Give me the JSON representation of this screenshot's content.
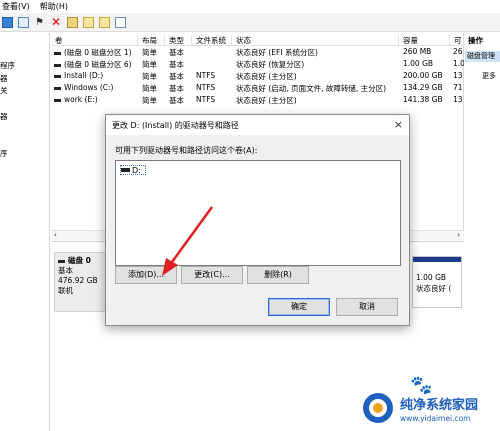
{
  "menu": {
    "items": [
      "查看(V)",
      "帮助(H)"
    ]
  },
  "left_nav": {
    "items": [
      "程序",
      "器",
      "关",
      "器",
      "",
      "序"
    ]
  },
  "table": {
    "headers": [
      "卷",
      "布局",
      "类型",
      "文件系统",
      "状态",
      "容量",
      "可"
    ],
    "rows": [
      [
        "(磁盘 0 磁盘分区 1)",
        "简单",
        "基本",
        "",
        "状态良好 (EFI 系统分区)",
        "260 MB",
        "26"
      ],
      [
        "(磁盘 0 磁盘分区 6)",
        "简单",
        "基本",
        "",
        "状态良好 (恢复分区)",
        "1.00 GB",
        "1.0"
      ],
      [
        "Install (D:)",
        "简单",
        "基本",
        "NTFS",
        "状态良好 (主分区)",
        "200.00 GB",
        "13"
      ],
      [
        "Windows (C:)",
        "简单",
        "基本",
        "NTFS",
        "状态良好 (启动, 页面文件, 故障转储, 主分区)",
        "134.29 GB",
        "71"
      ],
      [
        "work (E:)",
        "简单",
        "基本",
        "NTFS",
        "状态良好 (主分区)",
        "141.38 GB",
        "13"
      ]
    ],
    "scroll_left": "‹",
    "scroll_right": "›"
  },
  "actions": {
    "header": "操作",
    "selected": "磁盘管理",
    "more": "更多"
  },
  "disk": {
    "name": "磁盘 0",
    "type": "基本",
    "size": "476.92 GB",
    "status": "联机",
    "partition_size": "1.00 GB",
    "partition_status": "状态良好 ("
  },
  "dialog": {
    "title": "更改 D: (Install) 的驱动器号和路径",
    "close": "×",
    "label": "可用下列驱动器号和路径访问这个卷(A):",
    "list_item": "D:",
    "buttons": {
      "add": "添加(D)...",
      "change": "更改(C)...",
      "delete": "删除(R)",
      "ok": "确定",
      "cancel": "取消"
    }
  },
  "watermark": {
    "title": "纯净系统家园",
    "url": "www.yidaimei.com"
  },
  "colors": {
    "arrow": "#e02020",
    "accent": "#1e5fbf",
    "selection": "#cfe2f7"
  }
}
